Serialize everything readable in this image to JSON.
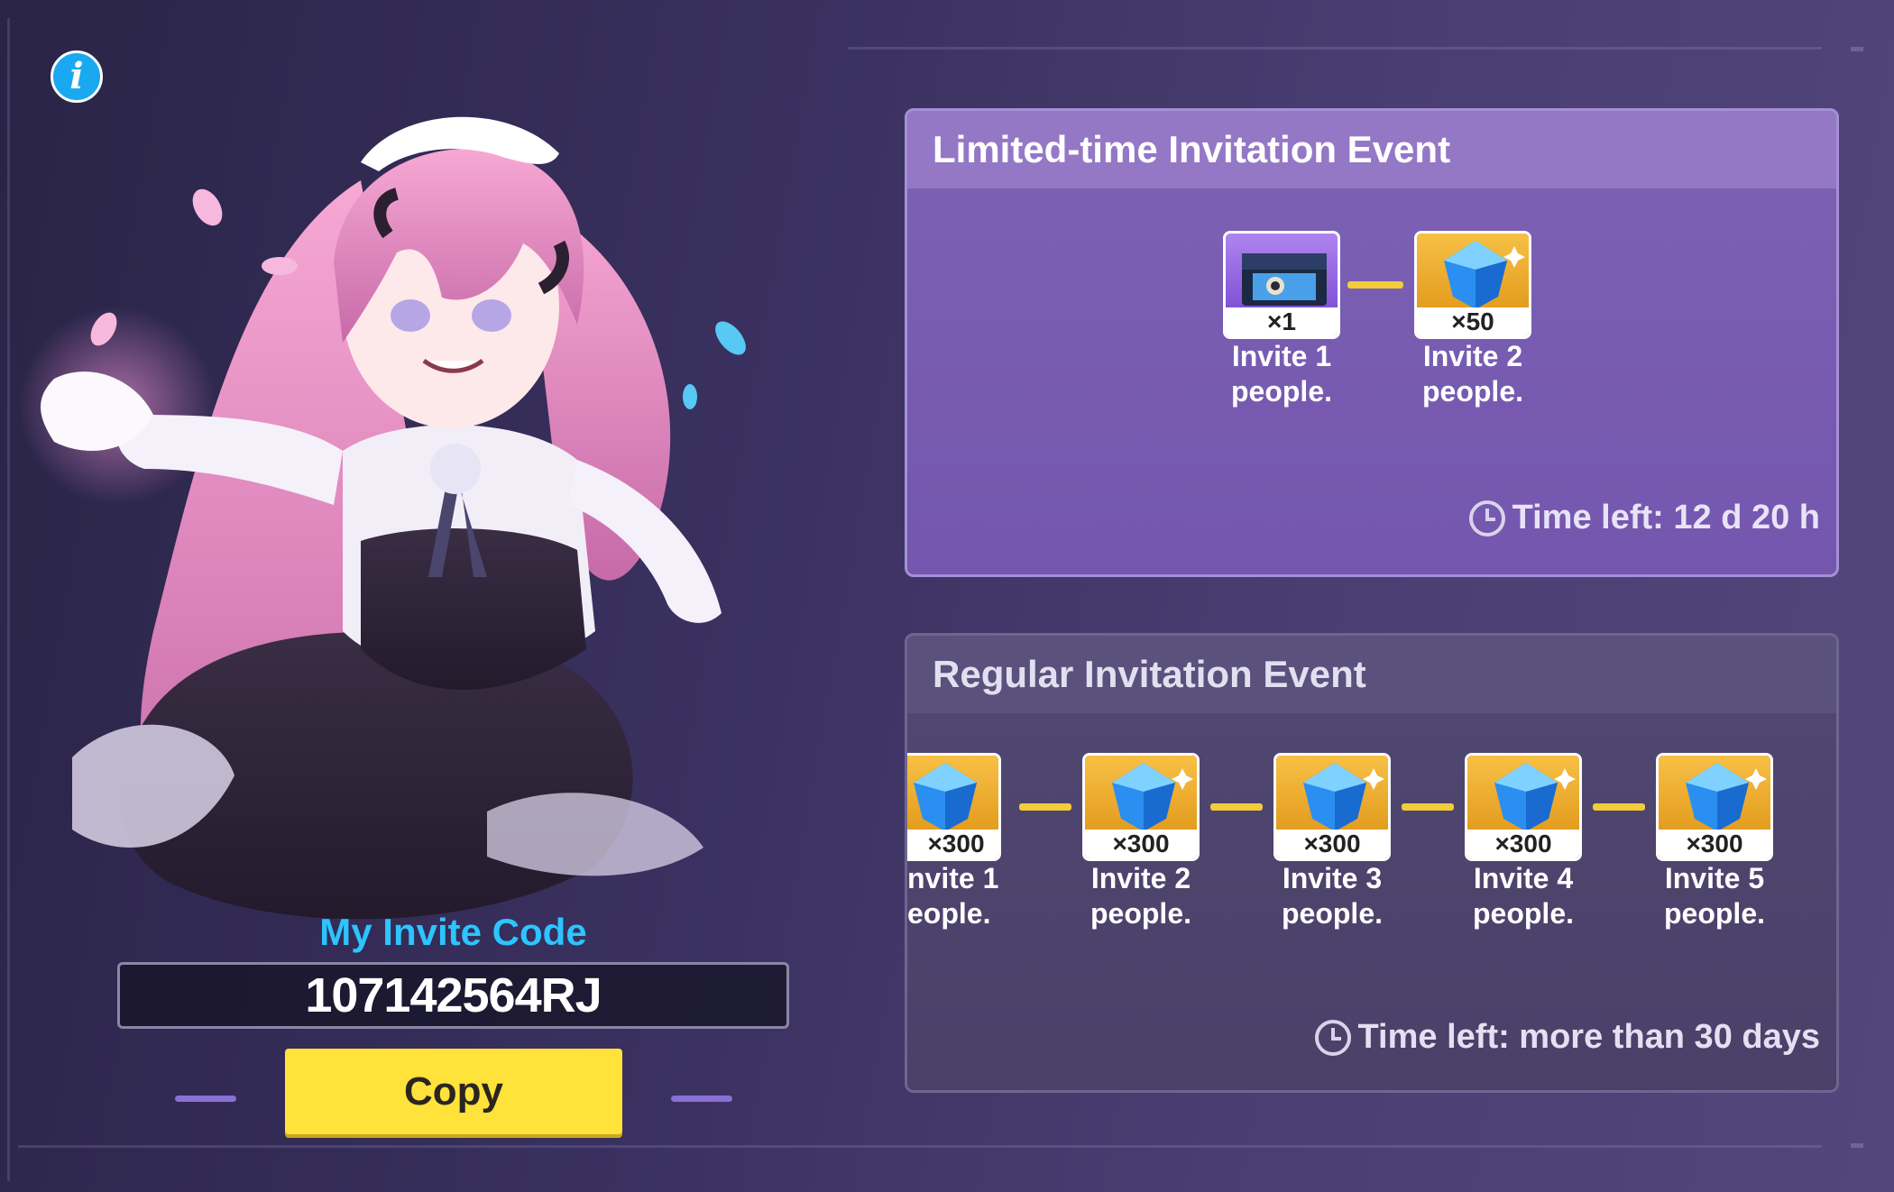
{
  "invite": {
    "title": "My Invite Code",
    "code": "107142564RJ",
    "copy_label": "Copy"
  },
  "limited_event": {
    "title": "Limited-time Invitation Event",
    "rewards": [
      {
        "icon": "supply-chest-icon",
        "quantity": "×1",
        "label_line1": "Invite 1",
        "label_line2": "people."
      },
      {
        "icon": "crystal-icon",
        "quantity": "×50",
        "label_line1": "Invite 2",
        "label_line2": "people."
      }
    ],
    "time_left": "Time left: 12 d 20 h"
  },
  "regular_event": {
    "title": "Regular Invitation Event",
    "rewards": [
      {
        "icon": "crystal-icon",
        "quantity": "×300",
        "label_line1": "nvite 1",
        "label_line2": "eople."
      },
      {
        "icon": "crystal-icon",
        "quantity": "×300",
        "label_line1": "Invite 2",
        "label_line2": "people."
      },
      {
        "icon": "crystal-icon",
        "quantity": "×300",
        "label_line1": "Invite 3",
        "label_line2": "people."
      },
      {
        "icon": "crystal-icon",
        "quantity": "×300",
        "label_line1": "Invite 4",
        "label_line2": "people."
      },
      {
        "icon": "crystal-icon",
        "quantity": "×300",
        "label_line1": "Invite 5",
        "label_line2": "people."
      }
    ],
    "time_left": "Time left: more than 30 days"
  },
  "colors": {
    "accent_blue": "#2cc5ff",
    "copy_button": "#ffe23a",
    "limited_panel": "#7c62b4",
    "regular_panel": "#514872",
    "connector": "#f2cc3a"
  }
}
